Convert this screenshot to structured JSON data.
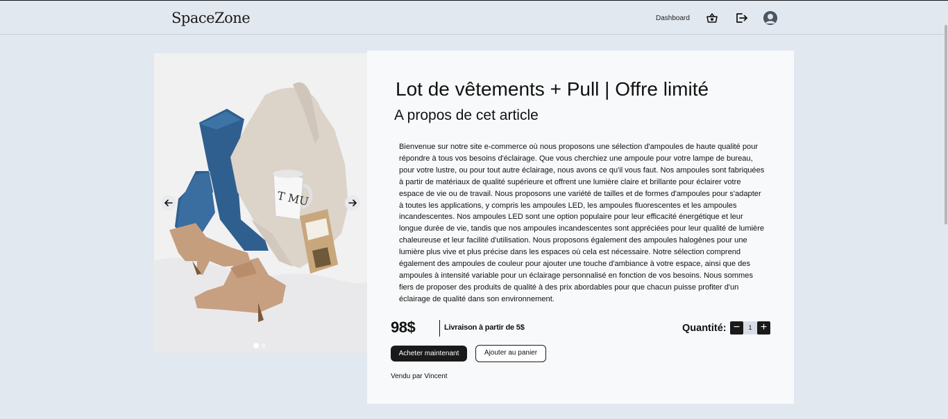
{
  "header": {
    "logo": "SpaceZone",
    "nav_dashboard": "Dashboard",
    "icons": [
      "basket-icon",
      "logout-icon",
      "avatar-icon"
    ]
  },
  "gallery": {
    "image_alt": "Vêtements : jean, pull, bottines et tasse",
    "prev_icon": "arrow-left-icon",
    "next_icon": "arrow-right-icon",
    "slide_count": 2,
    "active_slide": 1
  },
  "product": {
    "title": "Lot de vêtements + Pull | Offre limité",
    "subtitle": "A propos de cet article",
    "description": "Bienvenue sur notre site e-commerce où nous proposons une sélection d'ampoules de haute qualité pour répondre à tous vos besoins d'éclairage. Que vous cherchiez une ampoule pour votre lampe de bureau, pour votre lustre, ou pour tout autre éclairage, nous avons ce qu'il vous faut. Nos ampoules sont fabriquées à partir de matériaux de qualité supérieure et offrent une lumière claire et brillante pour éclairer votre espace de vie ou de travail. Nous proposons une variété de tailles et de formes d'ampoules pour s'adapter à toutes les applications, y compris les ampoules LED, les ampoules fluorescentes et les ampoules incandescentes. Nos ampoules LED sont une option populaire pour leur efficacité énergétique et leur longue durée de vie, tandis que nos ampoules incandescentes sont appréciées pour leur qualité de lumière chaleureuse et leur facilité d'utilisation. Nous proposons également des ampoules halogènes pour une lumière plus vive et plus précise dans les espaces où cela est nécessaire. Notre sélection comprend également des ampoules de couleur pour ajouter une touche d'ambiance à votre espace, ainsi que des ampoules à intensité variable pour un éclairage personnalisé en fonction de vos besoins. Nous sommes fiers de proposer des produits de qualité à des prix abordables pour que chacun puisse profiter d'un éclairage de qualité dans son environnement.",
    "price": "98$",
    "shipping": "Livraison à partir de 5$",
    "quantity_label": "Quantité:",
    "quantity_value": "1",
    "minus_label": "−",
    "plus_label": "+",
    "buy_now": "Acheter maintenant",
    "add_to_cart": "Ajouter au panier",
    "seller": "Vendu par Vincent"
  },
  "colors": {
    "page_bg": "#e2e8f0",
    "card_bg": "#f8f9fa",
    "primary": "#1a1a1a"
  }
}
